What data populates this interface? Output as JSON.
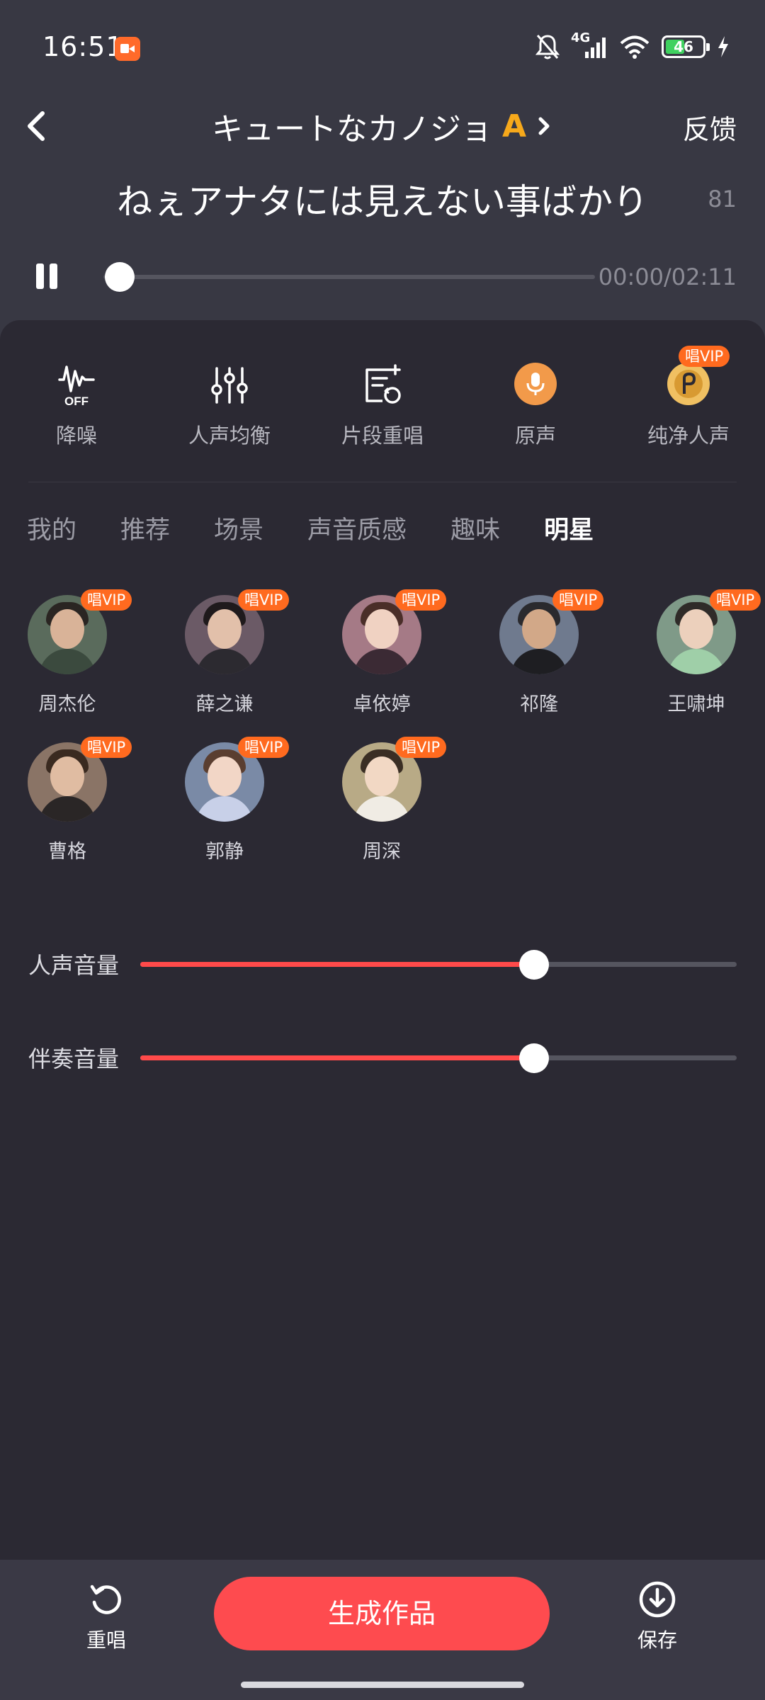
{
  "status_bar": {
    "time": "16:51",
    "network": "4G",
    "battery": "46",
    "icons": [
      "screen-record-icon",
      "bell-muted-icon",
      "signal-icon",
      "wifi-icon",
      "battery-icon",
      "charging-icon"
    ]
  },
  "header": {
    "song_title": "キュートなカノジョ",
    "level": "A",
    "feedback": "反馈",
    "icons": [
      "back-arrow-icon",
      "chevron-right-icon"
    ]
  },
  "lyric": {
    "text": "ねぇアナタには見えない事ばかり",
    "count": "81"
  },
  "playback": {
    "time": "00:00/02:11",
    "progress": 0
  },
  "tools": [
    {
      "label": "降噪",
      "icon": "noise-reduction-off-icon"
    },
    {
      "label": "人声均衡",
      "icon": "equalizer-sliders-icon"
    },
    {
      "label": "片段重唱",
      "icon": "segment-resing-icon"
    },
    {
      "label": "原声",
      "icon": "microphone-icon"
    },
    {
      "label": "纯净人声",
      "icon": "pure-voice-icon",
      "badge": "唱VIP"
    }
  ],
  "tabs": [
    "我的",
    "推荐",
    "场景",
    "声音质感",
    "趣味",
    "明星"
  ],
  "active_tab": "明星",
  "stars": [
    {
      "name": "周杰伦",
      "badge": "唱VIP"
    },
    {
      "name": "薛之谦",
      "badge": "唱VIP"
    },
    {
      "name": "卓依婷",
      "badge": "唱VIP"
    },
    {
      "name": "祁隆",
      "badge": "唱VIP"
    },
    {
      "name": "王啸坤",
      "badge": "唱VIP"
    },
    {
      "name": "曹格",
      "badge": "唱VIP"
    },
    {
      "name": "郭静",
      "badge": "唱VIP"
    },
    {
      "name": "周深",
      "badge": "唱VIP"
    }
  ],
  "sliders": {
    "vocal": {
      "label": "人声音量",
      "value": 0.66
    },
    "accompaniment": {
      "label": "伴奏音量",
      "value": 0.66
    }
  },
  "bottom": {
    "resing": "重唱",
    "generate": "生成作品",
    "save": "保存"
  },
  "colors": {
    "background": "#383843",
    "panel": "#2b2933",
    "accent_red": "#fe4b4f",
    "vip_orange": "#ff6a1f",
    "level_gold": "#f7a91b"
  }
}
